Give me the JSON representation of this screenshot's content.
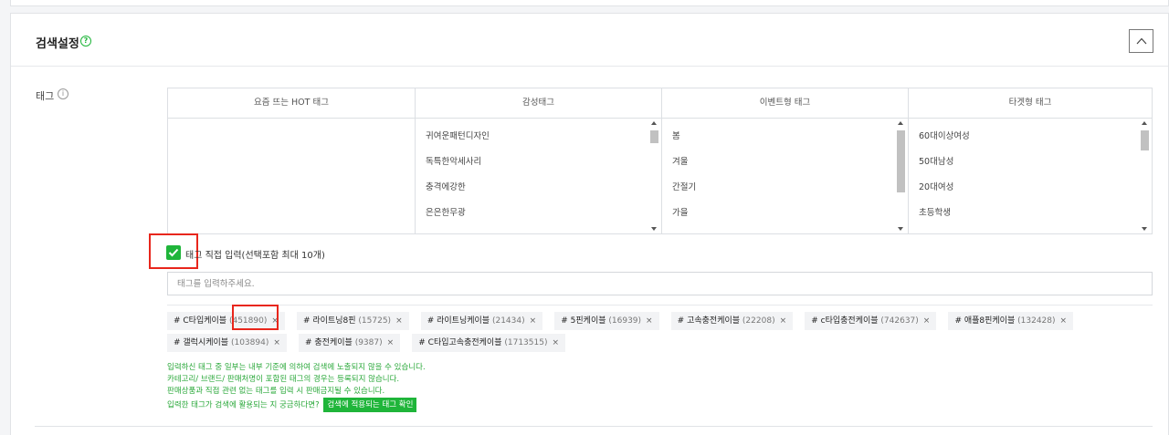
{
  "section": {
    "title": "검색설정",
    "help_icon": "question-circle-icon",
    "collapse_icon": "chevron-up-icon"
  },
  "tag_field": {
    "label": "태그",
    "info_icon": "info-circle-icon",
    "columns": [
      {
        "header": "요즘 뜨는 HOT 태그",
        "items": []
      },
      {
        "header": "감성태그",
        "items": [
          "귀여운패턴디자인",
          "독특한악세사리",
          "충격에강한",
          "은은한무광"
        ],
        "scroll_pos": 0.0
      },
      {
        "header": "이벤트형 태그",
        "items": [
          "봄",
          "겨울",
          "간절기",
          "가을"
        ],
        "scroll_pos": 0.0
      },
      {
        "header": "타겟형 태그",
        "items": [
          "60대이상여성",
          "50대남성",
          "20대여성",
          "초등학생"
        ],
        "scroll_pos": 0.0
      }
    ],
    "direct_input": {
      "checked": true,
      "label": "태그 직접 입력(선택포함 최대 10개)"
    },
    "input": {
      "placeholder": "태그를 입력하주세요.",
      "value": ""
    },
    "selected_tags": [
      {
        "name": "# C타입케이블",
        "count": "(451890)"
      },
      {
        "name": "# 라이트닝8핀",
        "count": "(15725)"
      },
      {
        "name": "# 라이트닝케이블",
        "count": "(21434)"
      },
      {
        "name": "# 5핀케이블",
        "count": "(16939)"
      },
      {
        "name": "# 고속충전케이블",
        "count": "(22208)"
      },
      {
        "name": "# c타입충전케이블",
        "count": "(742637)"
      },
      {
        "name": "# 애플8핀케이블",
        "count": "(132428)"
      },
      {
        "name": "# 갤럭시케이블",
        "count": "(103894)"
      },
      {
        "name": "# 충전케이블",
        "count": "(9387)"
      },
      {
        "name": "# C타입고속충전케이블",
        "count": "(1713515)"
      }
    ],
    "remove_symbol": "×",
    "notices": [
      "입력하신 태그 중 일부는 내부 기준에 의하여 검색에 노출되지 않을 수 있습니다.",
      "카테고리/ 브랜드/ 판매처명이 포함된 태그의 경우는 등록되지 않습니다.",
      "판매상품과 직접 관련 없는 태그를 입력 시 판매금지될 수 있습니다."
    ],
    "notice_question": "입력한 태그가 검색에 활용되는 지 궁금하다면?",
    "check_button_label": "검색에 적용되는 태그 확인",
    "accent_color": "#1fb53a",
    "highlight_color": "#e8261c"
  }
}
